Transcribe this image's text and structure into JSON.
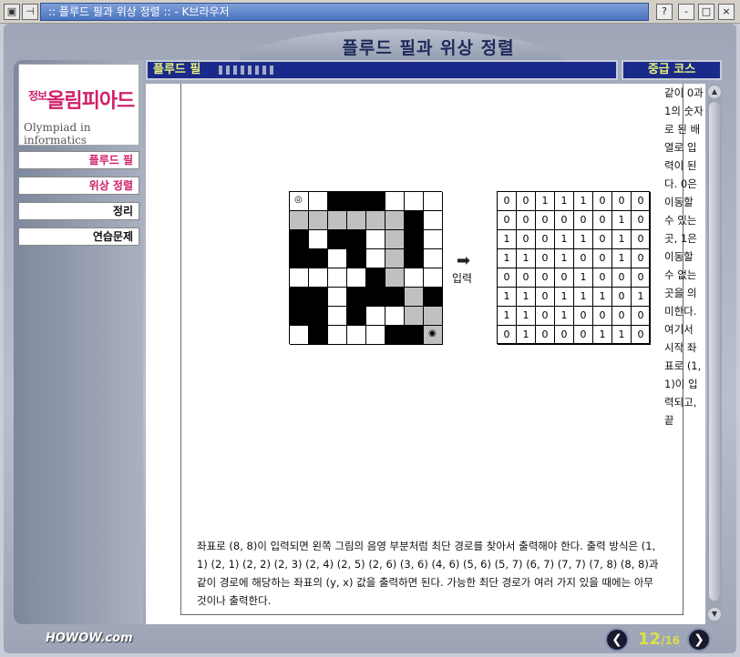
{
  "window": {
    "title": ":: 플루드 필과 위상 정렬 :: - K브라우저",
    "buttons": [
      "?",
      "-",
      "□",
      "×"
    ]
  },
  "page_title": "플루드 필과 위상 정렬",
  "header": {
    "section_label": "플루드 필",
    "course_label": "중급 코스"
  },
  "sidebar": {
    "logo_small": "정보",
    "logo_main": "올림피아드",
    "logo_en": "Olympiad in informatics",
    "items": [
      {
        "label": "플루드 필",
        "active": true
      },
      {
        "label": "위상 정렬",
        "active": true
      },
      {
        "label": "정리",
        "active": false
      },
      {
        "label": "연습문제",
        "active": false
      }
    ]
  },
  "content": {
    "side_text": "같이 0과 1의 숫자로 된 배열로 입력이 된다. 0은 이동할 수 있는 곳, 1은 이동할 수 없는 곳을 의미한다. 여기서 시작 좌표로 (1, 1)이 입력되고, 끝",
    "arrow_label": "입력",
    "bottom_text": "좌표로 (8, 8)이 입력되면 왼쪽 그림의 음영 부분처럼 최단 경로를 찾아서 출력해야 한다. 출력 방식은 (1, 1) (2, 1) (2, 2) (2, 3) (2, 4) (2, 5) (2, 6) (3, 6) (4, 6) (5, 6) (5, 7) (6, 7) (7, 7) (7, 8) (8, 8)과 같이 경로에 해당하는 좌표의 (y, x) 값을 출력하면 된다. 가능한 최단 경로가 여러 가지 있을 때에는 아무 것이나 출력한다.",
    "maze": [
      [
        "s",
        "w",
        "b",
        "b",
        "b",
        "w",
        "w",
        "w"
      ],
      [
        "g",
        "g",
        "g",
        "g",
        "g",
        "g",
        "b",
        "w"
      ],
      [
        "b",
        "w",
        "b",
        "b",
        "w",
        "g",
        "b",
        "w"
      ],
      [
        "b",
        "b",
        "w",
        "b",
        "w",
        "g",
        "b",
        "w"
      ],
      [
        "w",
        "w",
        "w",
        "w",
        "b",
        "g",
        "w",
        "w"
      ],
      [
        "b",
        "b",
        "w",
        "b",
        "b",
        "b",
        "g",
        "b"
      ],
      [
        "b",
        "b",
        "w",
        "b",
        "w",
        "w",
        "g",
        "g"
      ],
      [
        "w",
        "b",
        "w",
        "w",
        "w",
        "b",
        "b",
        "e"
      ]
    ],
    "matrix": [
      [
        "0",
        "0",
        "1",
        "1",
        "1",
        "0",
        "0",
        "0"
      ],
      [
        "0",
        "0",
        "0",
        "0",
        "0",
        "0",
        "1",
        "0"
      ],
      [
        "1",
        "0",
        "0",
        "1",
        "1",
        "0",
        "1",
        "0"
      ],
      [
        "1",
        "1",
        "0",
        "1",
        "0",
        "0",
        "1",
        "0"
      ],
      [
        "0",
        "0",
        "0",
        "0",
        "1",
        "0",
        "0",
        "0"
      ],
      [
        "1",
        "1",
        "0",
        "1",
        "1",
        "1",
        "0",
        "1"
      ],
      [
        "1",
        "1",
        "0",
        "1",
        "0",
        "0",
        "0",
        "0"
      ],
      [
        "0",
        "1",
        "0",
        "0",
        "0",
        "1",
        "1",
        "0"
      ]
    ]
  },
  "footer": {
    "brand": "HOWOW.com",
    "current_page": "12",
    "total_pages": "/16"
  }
}
